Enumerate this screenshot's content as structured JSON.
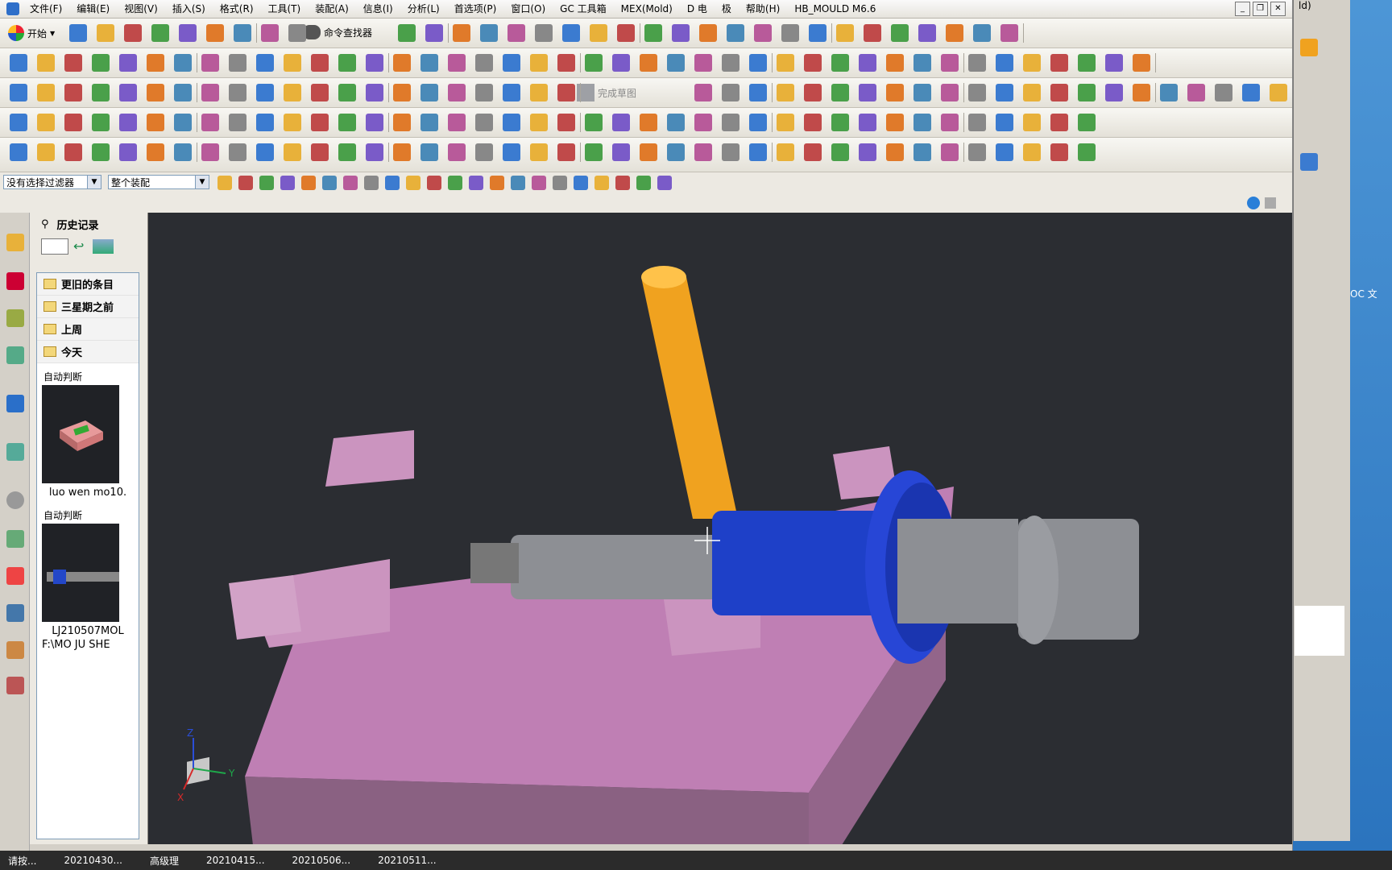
{
  "menu": {
    "items": [
      "文件(F)",
      "编辑(E)",
      "视图(V)",
      "插入(S)",
      "格式(R)",
      "工具(T)",
      "装配(A)",
      "信息(I)",
      "分析(L)",
      "首选项(P)",
      "窗口(O)",
      "GC 工具箱",
      "MEX(Mold)",
      "D 电",
      "极",
      "帮助(H)",
      "HB_MOULD M6.6"
    ]
  },
  "toolbar": {
    "start_label": "开始",
    "command_finder_label": "命令查找器",
    "sketch_done_label": "完成草图"
  },
  "filters": {
    "selection_filter": "没有选择过滤器",
    "scope": "整个装配"
  },
  "history": {
    "title": "历史记录",
    "folders": [
      "更旧的条目",
      "三星期之前",
      "上周",
      "今天"
    ],
    "entries": [
      {
        "type_label": "自动判断",
        "caption": "luo wen mo10."
      },
      {
        "type_label": "自动判断",
        "caption": "LJ210507MOL",
        "path": "F:\\MO JU SHE"
      }
    ]
  },
  "viewport": {
    "axis_labels": {
      "x": "X",
      "y": "Y",
      "z": "Z"
    },
    "colors": {
      "background": "#2b2d32",
      "mold_block": "#d88fc8",
      "core_pin": "#f0a21f",
      "blue_sleeve": "#1e40c8",
      "grey_shaft": "#8d8f94"
    }
  },
  "right_app": {
    "partial_title": "ld)",
    "partial_label": "OC 文"
  },
  "taskbar": {
    "items": [
      "请按...",
      "20210430...",
      "高级理",
      "20210415...",
      "20210506...",
      "20210511..."
    ]
  }
}
